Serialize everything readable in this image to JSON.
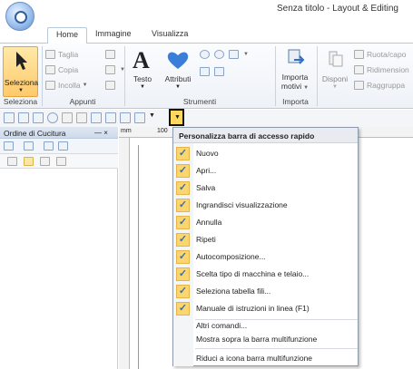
{
  "title": "Senza titolo - Layout & Editing",
  "tabs": [
    "Home",
    "Immagine",
    "Visualizza"
  ],
  "ribbon": {
    "seleziona": {
      "button": "Seleziona",
      "group": "Seleziona"
    },
    "appunti": {
      "taglia": "Taglia",
      "copia": "Copia",
      "incolla": "Incolla",
      "group": "Appunti"
    },
    "strumenti": {
      "testo": "Testo",
      "attributi": "Attributi",
      "group": "Strumenti"
    },
    "importa": {
      "button_line1": "Importa",
      "button_line2": "motivi",
      "group": "Importa"
    },
    "disponi": {
      "button": "Disponi",
      "ruota": "Ruota/capo",
      "ridimensiona": "Ridimension",
      "raggruppa": "Raggruppa"
    }
  },
  "panel": {
    "title": "Ordine di Cucitura",
    "pin": "— ×"
  },
  "ruler": {
    "unit": "mm",
    "label": "100"
  },
  "menu": {
    "header": "Personalizza barra di accesso rapido",
    "checked_items": [
      "Nuovo",
      "Apri...",
      "Salva",
      "Ingrandisci visualizzazione",
      "Annulla",
      "Ripeti",
      "Autocomposizione...",
      "Scelta tipo di macchina e telaio...",
      "Seleziona tabella fili...",
      "Manuale di istruzioni in linea (F1)"
    ],
    "altri_comandi": "Altri comandi...",
    "mostra_sopra": "Mostra sopra la barra multifunzione",
    "riduci": "Riduci a icona barra multifunzione"
  },
  "colors": {
    "accent": "#ffc96b",
    "check_bg": "#fbd66f",
    "check_mark": "#3a6fb0",
    "ribbon_border": "#b8c8dd"
  }
}
